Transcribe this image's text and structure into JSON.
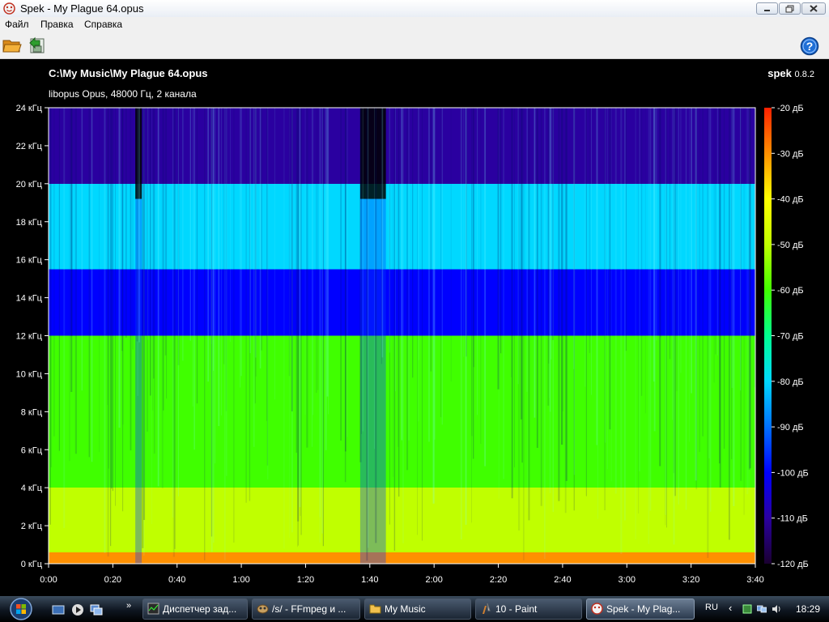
{
  "window": {
    "title": "Spek - My Plague 64.opus"
  },
  "menu": {
    "items": [
      "Файл",
      "Правка",
      "Справка"
    ]
  },
  "toolbar": {
    "open_icon": "folder-open-icon",
    "save_icon": "save-export-icon",
    "help_icon": "help-icon"
  },
  "header": {
    "file_path": "C:\\My Music\\My Plague 64.opus",
    "file_info": "libopus Opus, 48000 Гц, 2 канала",
    "app_name": "spek",
    "app_version": "0.8.2"
  },
  "chart_data": {
    "type": "heatmap",
    "x_tick_labels": [
      "0:00",
      "0:20",
      "0:40",
      "1:00",
      "1:20",
      "1:40",
      "2:00",
      "2:20",
      "2:40",
      "3:00",
      "3:20",
      "3:40"
    ],
    "y_tick_labels": [
      "0 кГц",
      "2 кГц",
      "4 кГц",
      "6 кГц",
      "8 кГц",
      "10 кГц",
      "12 кГц",
      "14 кГц",
      "16 кГц",
      "18 кГц",
      "20 кГц",
      "22 кГц",
      "24 кГц"
    ],
    "colorbar_labels": [
      "-20 дБ",
      "-30 дБ",
      "-40 дБ",
      "-50 дБ",
      "-60 дБ",
      "-70 дБ",
      "-80 дБ",
      "-90 дБ",
      "-100 дБ",
      "-110 дБ",
      "-120 дБ"
    ],
    "xlim_seconds": [
      0,
      220
    ],
    "ylim_khz": [
      0,
      24
    ],
    "zlim_db": [
      -120,
      -20
    ],
    "colormap": [
      "#1a0030",
      "#2a00a0",
      "#0000ff",
      "#0070ff",
      "#00d8ff",
      "#00ff90",
      "#40ff00",
      "#c0ff00",
      "#ffff00",
      "#ff9000",
      "#ff2000"
    ],
    "bands": [
      {
        "from_khz": 0,
        "to_khz": 0.6,
        "db": -30
      },
      {
        "from_khz": 0.6,
        "to_khz": 4,
        "db": -48
      },
      {
        "from_khz": 4,
        "to_khz": 8,
        "db": -56
      },
      {
        "from_khz": 8,
        "to_khz": 12,
        "db": -63
      },
      {
        "from_khz": 12,
        "to_khz": 15.5,
        "db": -97
      },
      {
        "from_khz": 15.5,
        "to_khz": 20,
        "db": -78
      },
      {
        "from_khz": 20,
        "to_khz": 24,
        "db": -112
      }
    ],
    "quiet_segments_seconds": [
      [
        27,
        29
      ],
      [
        97,
        105
      ]
    ]
  },
  "taskbar": {
    "tasks": [
      {
        "label": "Диспетчер зад...",
        "icon": "task-manager-icon",
        "active": false
      },
      {
        "label": "/s/ - FFmpeg и ...",
        "icon": "browser-icon",
        "active": false
      },
      {
        "label": "My Music",
        "icon": "folder-icon",
        "active": false
      },
      {
        "label": "10 - Paint",
        "icon": "paint-icon",
        "active": false
      },
      {
        "label": "Spek - My Plag...",
        "icon": "spek-icon",
        "active": true
      }
    ],
    "language": "RU",
    "clock": "18:29"
  }
}
